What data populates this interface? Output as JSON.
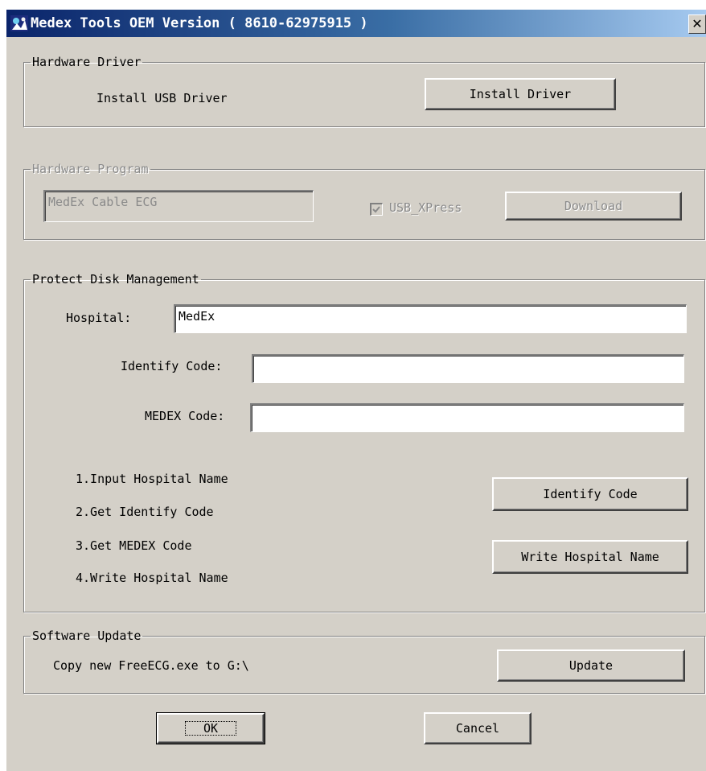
{
  "window": {
    "title": "Medex Tools OEM Version ( 8610-62975915 )",
    "close_label": "✕"
  },
  "hardware_driver": {
    "legend": "Hardware Driver",
    "label": "Install USB Driver",
    "button": "Install Driver"
  },
  "hardware_program": {
    "legend": "Hardware Program",
    "device_value": "MedEx Cable ECG",
    "checkbox_label": "USB_XPress",
    "checkbox_checked": true,
    "button": "Download"
  },
  "protect_disk": {
    "legend": "Protect Disk Management",
    "hospital_label": "Hospital:",
    "hospital_value": "MedEx",
    "identify_label": "Identify Code:",
    "identify_value": "",
    "medex_label": "MEDEX Code:",
    "medex_value": "",
    "steps": [
      "1.Input Hospital Name",
      "2.Get Identify Code",
      "3.Get MEDEX Code",
      "4.Write Hospital Name"
    ],
    "identify_button": "Identify Code",
    "write_button": "Write Hospital Name"
  },
  "software_update": {
    "legend": "Software Update",
    "label": "Copy new FreeECG.exe to G:\\",
    "button": "Update"
  },
  "footer": {
    "ok": "OK",
    "cancel": "Cancel"
  },
  "colors": {
    "dialog_bg": "#d4d0c8",
    "title_start": "#0a246a",
    "title_end": "#a6caf0"
  }
}
